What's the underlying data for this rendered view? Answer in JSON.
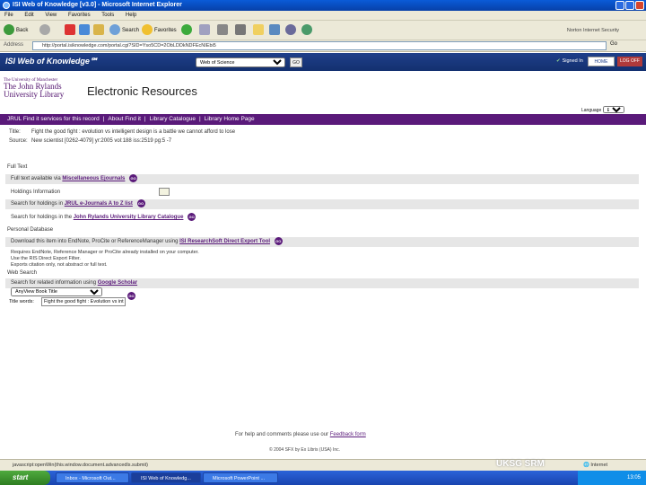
{
  "window": {
    "title": "ISI Web of Knowledge [v3.0] - Microsoft Internet Explorer"
  },
  "menu": [
    "File",
    "Edit",
    "View",
    "Favorites",
    "Tools",
    "Help"
  ],
  "toolbar": {
    "back": "Back",
    "search": "Search",
    "favorites": "Favorites",
    "norton": "Norton Internet Security"
  },
  "address": {
    "label": "Address",
    "url": "http://portal.isiknowledge.com/portal.cgi?SID=Yso5CD=2ObLDDkNDFEcNIEbi5",
    "go": "Go"
  },
  "wos": {
    "logo": "ISI Web of Knowledge℠",
    "database": "Web of Science",
    "go": "GO",
    "signed_in": "Signed In",
    "home": "HOME",
    "logout": "LOG OFF"
  },
  "library": {
    "logo_l1": "The University of Manchester",
    "logo_l2": "The John Rylands",
    "logo_l3": "University Library",
    "page_title": "Electronic Resources"
  },
  "purple_nav": {
    "items": [
      "JRUL Find it services for this record",
      "About Find it",
      "Library Catalogue",
      "Library Home Page"
    ],
    "sep": "|"
  },
  "language": {
    "label": "Language",
    "value": "English"
  },
  "record": {
    "title_label": "Title:",
    "title": "Fight the good fight : evolution vs intelligent design is a battle we cannot afford to lose",
    "source_label": "Source:",
    "source": "New scientist [0262-4079] yr:2005 vol:188 iss:2519 pg:5 -7"
  },
  "full_text": {
    "heading": "Full Text",
    "avail_prefix": "Full text available via",
    "avail_link": "Miscellaneous Ejournals",
    "holdings": "Holdings Information",
    "search_ejournals_prefix": "Search for holdings in",
    "search_ejournals_link": "JRUL e-Journals A to Z list",
    "search_catalogue_prefix": "Search for holdings in the",
    "search_catalogue_link": "John Rylands University Library Catalogue"
  },
  "personal_db": {
    "heading": "Personal Database",
    "download_prefix": "Download this item into EndNote, ProCite or ReferenceManager using",
    "download_link": "ISI ResearchSoft Direct Export Tool",
    "note_lines": [
      "Requires EndNote, Reference Manager or ProCite already installed on your computer.",
      "Use the RIS Direct Export Filter.",
      "Exports citation only, not abstract or full text."
    ]
  },
  "web_search": {
    "heading": "Web Search",
    "prefix": "Search for related information using",
    "link": "Google Scholar",
    "select_value": "AnyView Book Title",
    "title_label": "Title words:",
    "title_value": "Fight the good fight : Evolution vs int"
  },
  "go_label": "GO",
  "footer": {
    "text": "For help and comments please use our",
    "link": "Feedback form",
    "copyright": "© 2004 SFX by Ex Libris (USA) Inc."
  },
  "status": {
    "text": "javascript:openWin(this.window.document.advancedls.submit)",
    "zone": "Internet",
    "watermark": "UKSG SRM"
  },
  "taskbar": {
    "start": "start",
    "items": [
      "Inbox - Microsoft Out...",
      "ISI Web of Knowledg...",
      "Microsoft PowerPoint ..."
    ],
    "clock": "13:05"
  },
  "colors": {
    "purple": "#5a1a7a",
    "wos_blue": "#1f3f8a"
  }
}
